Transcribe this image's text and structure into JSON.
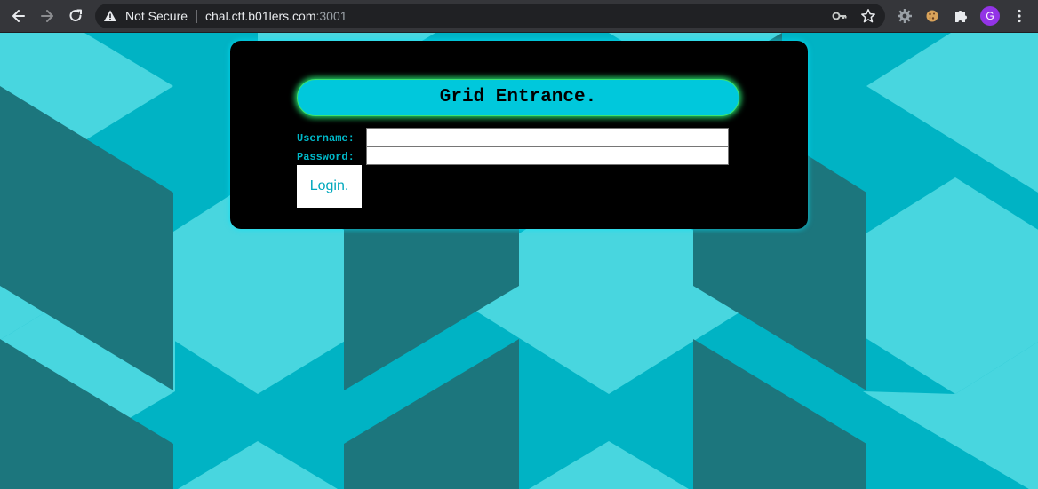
{
  "browser": {
    "security_label": "Not Secure",
    "url_host": "chal.ctf.b01lers.com",
    "url_port": ":3001",
    "profile_initial": "G",
    "icons": [
      "back-icon",
      "forward-icon",
      "reload-icon",
      "warning-icon",
      "key-icon",
      "star-icon",
      "extension-gear-icon",
      "extension-cookie-icon",
      "extensions-puzzle-icon",
      "menu-icon"
    ]
  },
  "page": {
    "heading": "Grid Entrance.",
    "username_label": "Username:",
    "password_label": "Password:",
    "username_value": "",
    "password_value": "",
    "login_label": "Login."
  },
  "colors": {
    "background_cyan": "#00b3c4",
    "light_face": "#48d6df",
    "dark_face": "#1c767d",
    "banner": "#00c8dc",
    "banner_glow": "#24d96b",
    "label_text": "#00b8c8"
  }
}
